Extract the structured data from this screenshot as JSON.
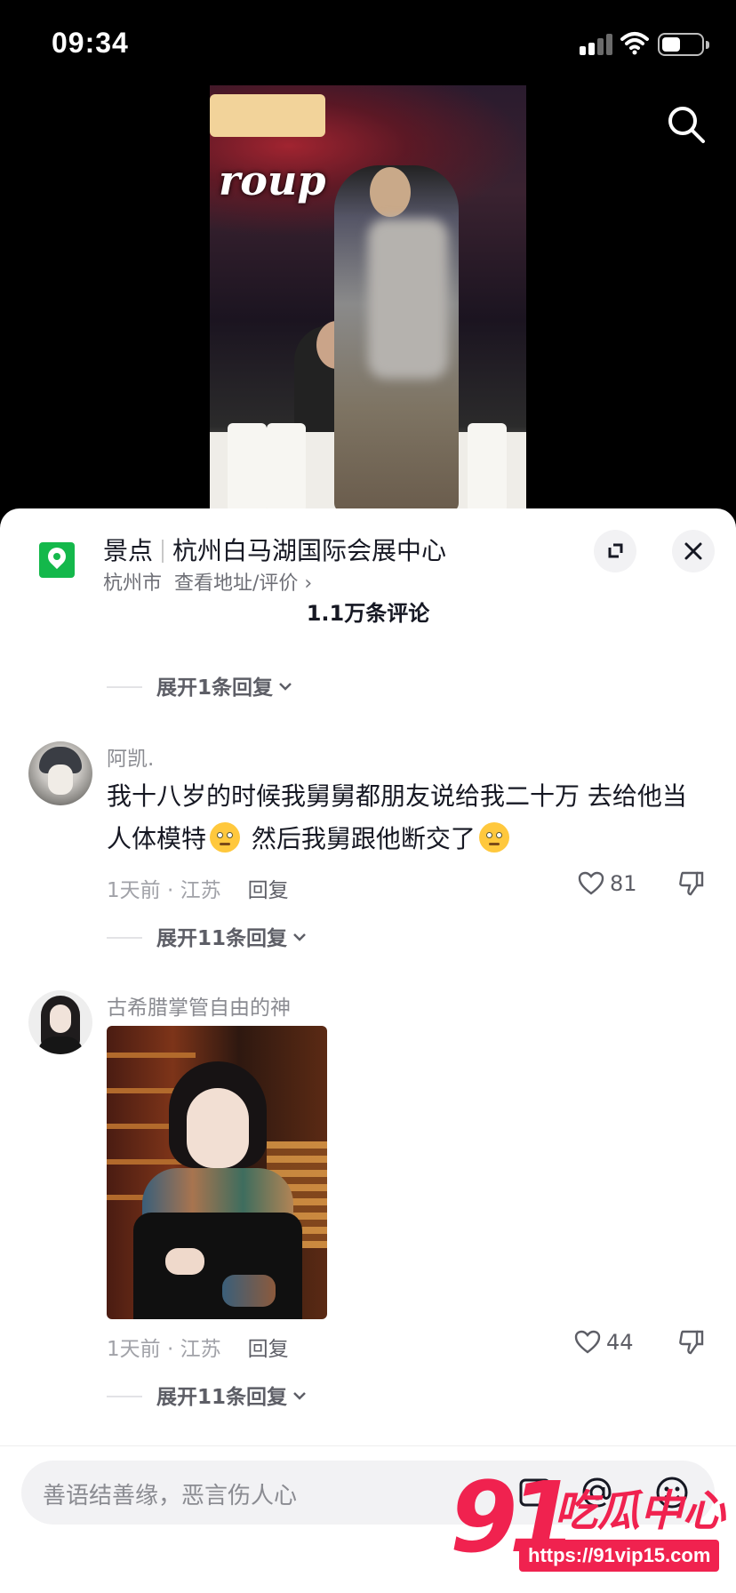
{
  "status_bar": {
    "time": "09:34"
  },
  "location": {
    "category": "景点",
    "name": "杭州白马湖国际会展中心",
    "city": "杭州市",
    "link": "查看地址/评价 ›"
  },
  "comment_count": "1.1万条评论",
  "expand_first": "展开1条回复",
  "comments": [
    {
      "user": "阿凯.",
      "text_part1": "我十八岁的时候我舅舅都朋友说给我二十万 去给他当人体模特",
      "text_part2": "然后我舅跟他断交了",
      "time": "1天前 · 江苏",
      "reply": "回复",
      "likes": "81",
      "expand": "展开11条回复"
    },
    {
      "user": "古希腊掌管自由的神",
      "time": "1天前 · 江苏",
      "reply": "回复",
      "likes": "44",
      "expand": "展开11条回复"
    }
  ],
  "input": {
    "placeholder": "善语结善缘，恶言伤人心"
  },
  "watermark": {
    "number": "91",
    "brand": "吃瓜中心",
    "url": "https://91vip15.com"
  },
  "colors": {
    "accent_green": "#14b84b",
    "watermark_red": "#f0224f"
  }
}
